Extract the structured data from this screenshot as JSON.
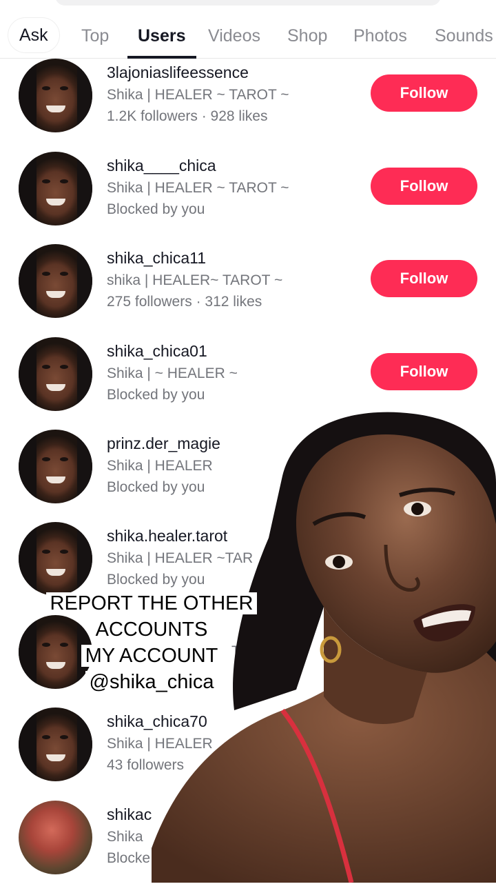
{
  "tabs": [
    "Ask",
    "Top",
    "Users",
    "Videos",
    "Shop",
    "Photos",
    "Sounds"
  ],
  "follow_label": "Follow",
  "users": [
    {
      "username": "3lajonias​lifeessence",
      "bio": "Shika | HEALER ~ TAROT ~",
      "meta": "1.2K followers · 928 likes"
    },
    {
      "username": "shika____chica",
      "bio": "Shika | HEALER ~ TAROT ~",
      "meta": "Blocked by you"
    },
    {
      "username": "shika_chica11",
      "bio": "shika | HEALER~ TAROT ~",
      "meta": "275 followers · 312 likes"
    },
    {
      "username": "shika_chica01",
      "bio": "Shika | ~ HEALER ~",
      "meta": "Blocked by you"
    },
    {
      "username": "prinz.der_magie",
      "bio": "Shika | HEALER",
      "meta": "Blocked by you"
    },
    {
      "username": "shika.healer.tarot",
      "bio": "Shika | HEALER ~TAR",
      "meta": "Blocked by you"
    },
    {
      "username": "",
      "bio": "TARO",
      "meta": ""
    },
    {
      "username": "shika_chica70",
      "bio": "Shika | HEALER",
      "meta": "43 followers"
    },
    {
      "username": "shikac",
      "bio": "Shika",
      "meta": "Blocke"
    }
  ],
  "caption": [
    "REPORT THE OTHER",
    "ACCOUNTS",
    "MY ACCOUNT",
    "@shika_chica"
  ],
  "colors": {
    "accent": "#fe2c55",
    "text": "#161823",
    "muted": "#73757b"
  }
}
